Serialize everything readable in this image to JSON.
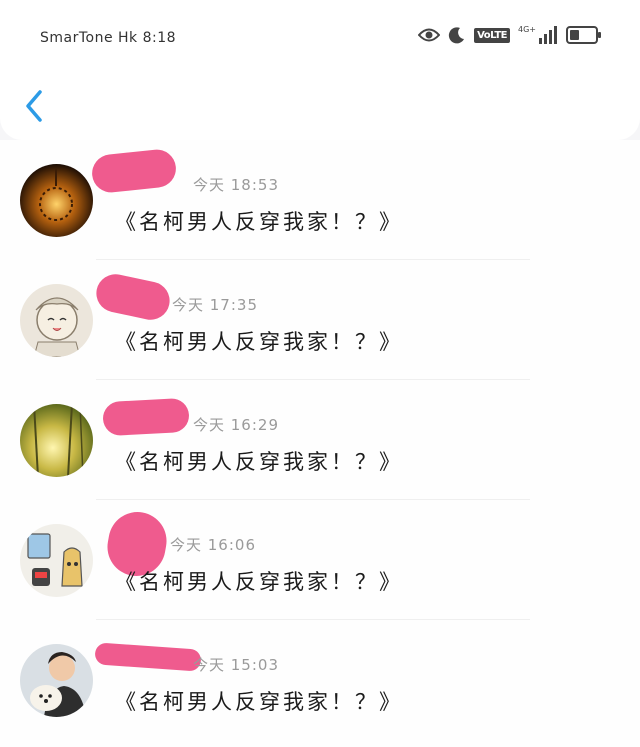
{
  "status_bar": {
    "carrier": "SmarTone Hk",
    "time": "8:18",
    "volte": "VoLTE",
    "network": "4G+"
  },
  "header": {
    "back_icon": "chevron-left-icon",
    "accent_color": "#2c9be6"
  },
  "redaction_color": "#ef5b8e",
  "messages": [
    {
      "time": "今天 18:53",
      "text": "《名柯男人反穿我家！？》"
    },
    {
      "time": "今天 17:35",
      "text": "《名柯男人反穿我家！？》"
    },
    {
      "time": "今天 16:29",
      "text": "《名柯男人反穿我家！？》"
    },
    {
      "time": "今天 16:06",
      "text": "《名柯男人反穿我家！？》"
    },
    {
      "time": "今天 15:03",
      "text": "《名柯男人反穿我家！？》"
    }
  ]
}
